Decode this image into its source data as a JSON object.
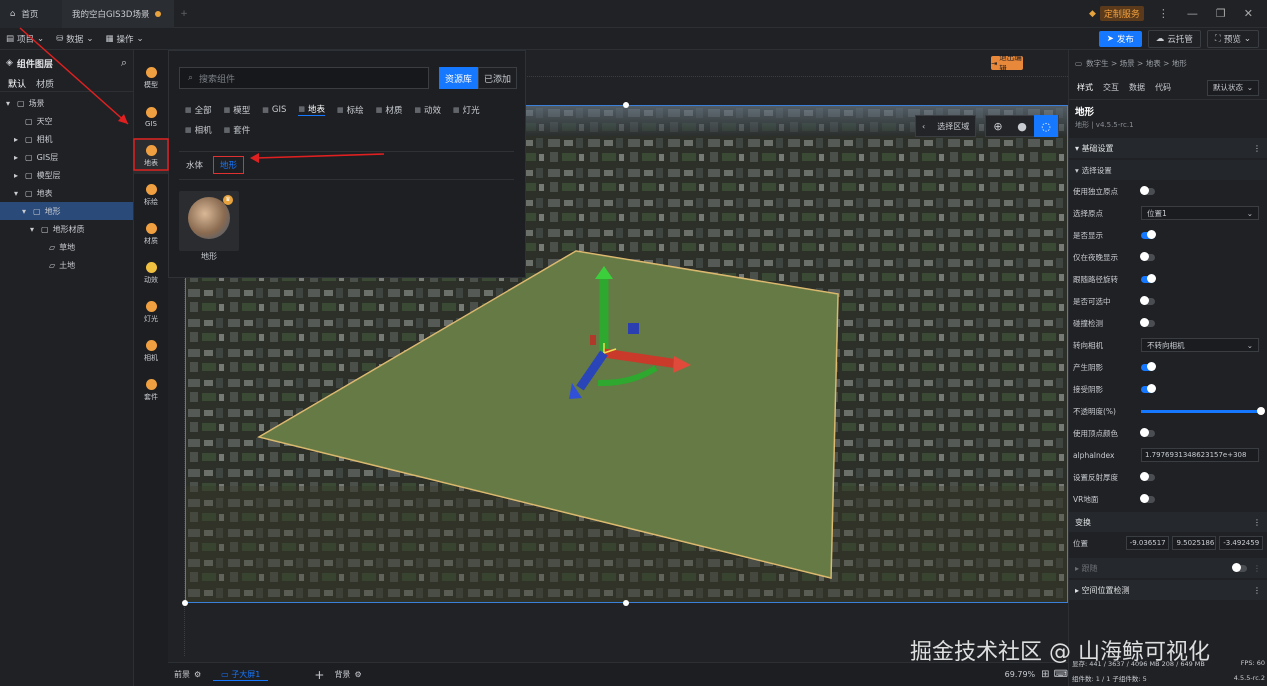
{
  "titlebar": {
    "home_tab": "首页",
    "scene_tab": "我的空白GIS3D场景",
    "custom_service": "定制服务"
  },
  "toolbar": {
    "project": "项目",
    "data": "数据",
    "operate": "操作",
    "publish": "发布",
    "cloud": "云托管",
    "preview": "预览"
  },
  "left_panel": {
    "title": "组件图层",
    "tabs": [
      "默认",
      "材质"
    ],
    "tree": [
      {
        "label": "场景",
        "indent": 0,
        "arrow": "▾"
      },
      {
        "label": "天空",
        "indent": 1,
        "arrow": ""
      },
      {
        "label": "相机",
        "indent": 1,
        "arrow": "▸"
      },
      {
        "label": "GIS层",
        "indent": 1,
        "arrow": "▸"
      },
      {
        "label": "模型层",
        "indent": 1,
        "arrow": "▸"
      },
      {
        "label": "地表",
        "indent": 1,
        "arrow": "▾"
      },
      {
        "label": "地形",
        "indent": 2,
        "arrow": "▾"
      },
      {
        "label": "地形材质",
        "indent": 3,
        "arrow": "▾"
      },
      {
        "label": "草地",
        "indent": 4,
        "arrow": ""
      },
      {
        "label": "土地",
        "indent": 4,
        "arrow": ""
      }
    ]
  },
  "rail": [
    "模型",
    "GIS",
    "地表",
    "标绘",
    "材质",
    "动效",
    "灯光",
    "相机",
    "套件"
  ],
  "popup": {
    "search_placeholder": "搜索组件",
    "resource_btn": "资源库",
    "added_btn": "已添加",
    "categories": [
      "全部",
      "模型",
      "GIS",
      "地表",
      "标绘",
      "材质",
      "动效",
      "灯光",
      "相机",
      "套件"
    ],
    "subtabs": [
      "水体",
      "地形"
    ],
    "item_label": "地形"
  },
  "viewport": {
    "exit_edit": "退出编辑",
    "select_area": "选择区域",
    "zoom": "69.79%",
    "bottom_tabs": {
      "front": "前景",
      "sub": "子大屏1",
      "back": "背景"
    }
  },
  "right_panel": {
    "breadcrumb": "数字生 > 场景 > 地表 > 地形",
    "tabs": [
      "样式",
      "交互",
      "数据",
      "代码"
    ],
    "state": "默认状态",
    "comp_title": "地形",
    "comp_sub": "地形 | v4.5.5-rc.1",
    "sec_basic": "基础设置",
    "sec_select": "选择设置",
    "props": [
      {
        "label": "使用独立原点",
        "type": "toggle",
        "on": false
      },
      {
        "label": "选择原点",
        "type": "select",
        "value": "位置1"
      },
      {
        "label": "是否显示",
        "type": "toggle",
        "on": true
      },
      {
        "label": "仅在夜晚显示",
        "type": "toggle",
        "on": false
      },
      {
        "label": "跟随路径旋转",
        "type": "toggle",
        "on": true
      },
      {
        "label": "是否可选中",
        "type": "toggle",
        "on": false
      },
      {
        "label": "碰撞检测",
        "type": "toggle",
        "on": false
      },
      {
        "label": "转向相机",
        "type": "select",
        "value": "不转向相机"
      },
      {
        "label": "产生阴影",
        "type": "toggle",
        "on": true
      },
      {
        "label": "接受阴影",
        "type": "toggle",
        "on": true
      },
      {
        "label": "不透明度(%)",
        "type": "slider",
        "value": 100
      },
      {
        "label": "使用顶点颜色",
        "type": "toggle",
        "on": false
      },
      {
        "label": "alphaIndex",
        "type": "input",
        "value": "1.7976931348623157e+308"
      },
      {
        "label": "设置反射厚度",
        "type": "toggle",
        "on": false
      },
      {
        "label": "VR地面",
        "type": "toggle",
        "on": false
      }
    ],
    "sec_transform": "变换",
    "position_label": "位置",
    "position_values": [
      "-9.036517",
      "9.5025186",
      "-3.492459"
    ],
    "sec_follow": "跟随",
    "sec_space": "空间位置检测",
    "stats": "显存: 441 / 3637 / 4096 MB  208 / 649 MB",
    "fps": "FPS: 60",
    "count": "组件数: 1 / 1  子组件数: 5",
    "version": "4.5.5-rc.2"
  },
  "watermark": "掘金技术社区 @ 山海鲸可视化"
}
